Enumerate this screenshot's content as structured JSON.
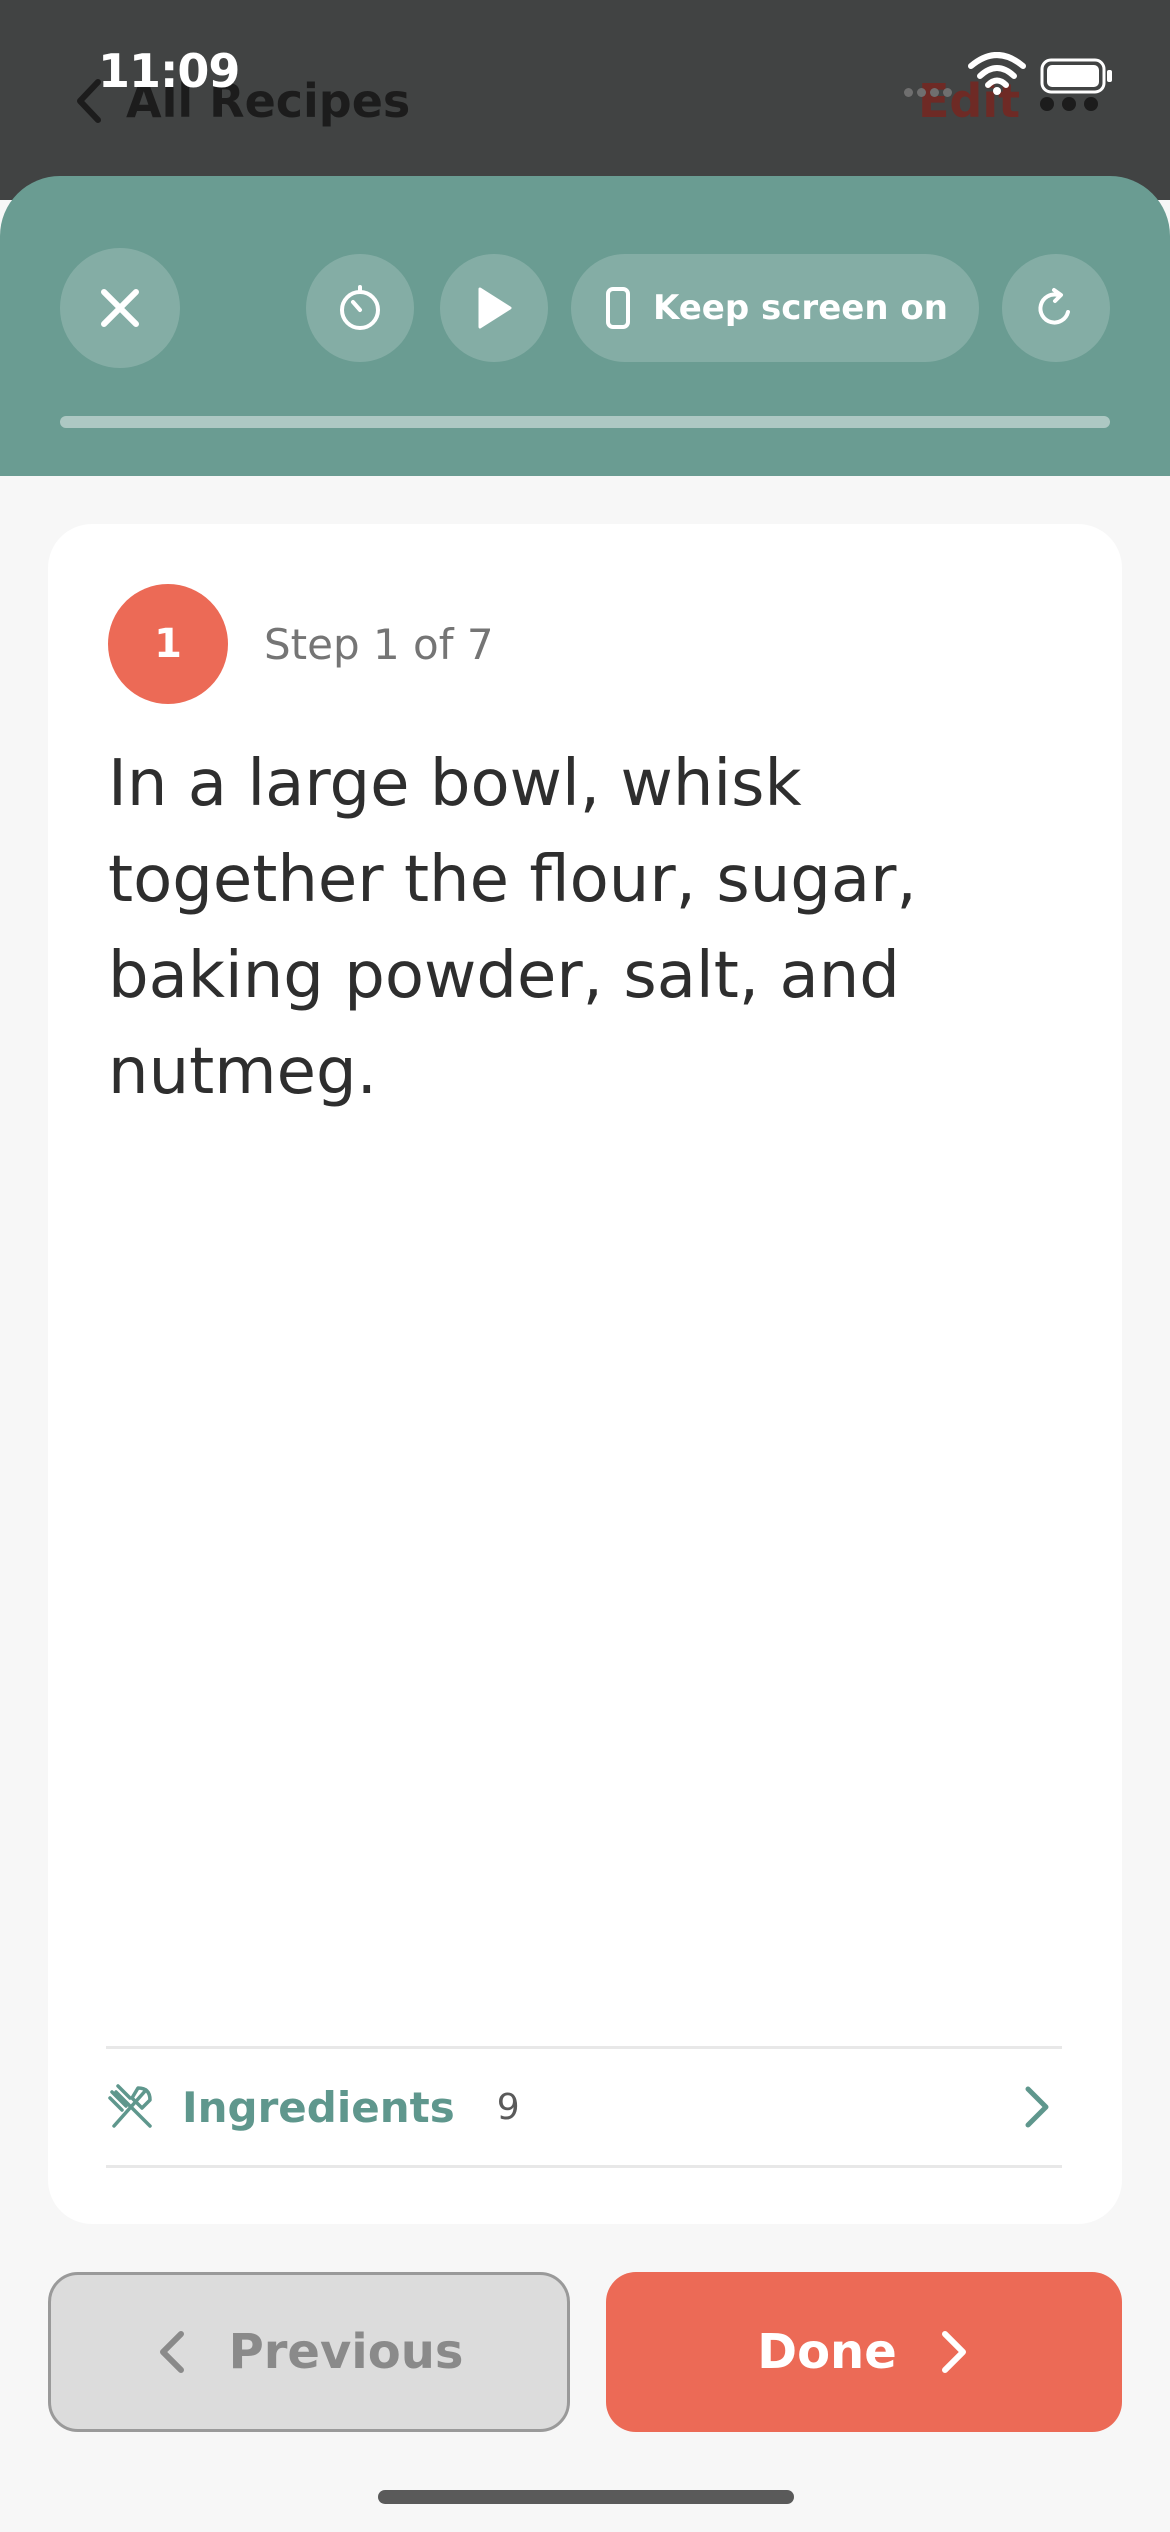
{
  "status_bar": {
    "time": "11:09",
    "icons": [
      "cellular-dots-icon",
      "wifi-icon",
      "battery-icon"
    ]
  },
  "nav_bar": {
    "back_label": "All Recipes",
    "edit_label": "Edit",
    "more_icon": "more-dots-icon"
  },
  "cook_mode": {
    "keep_screen_label": "Keep screen on",
    "progress": 0,
    "icons": [
      "close-icon",
      "timer-icon",
      "play-icon",
      "phone-icon",
      "refresh-icon"
    ]
  },
  "step": {
    "number": "1",
    "count_label": "Step 1 of 7",
    "text": "In a large bowl, whisk together the flour, sugar, baking powder, salt, and nutmeg."
  },
  "ingredients": {
    "label": "Ingredients",
    "count": "9",
    "icon": "utensils-icon"
  },
  "footer": {
    "previous_label": "Previous",
    "done_label": "Done"
  },
  "colors": {
    "accent": "#ec6a56",
    "panel": "#6a9c92",
    "ingredient_text": "#5f978d"
  }
}
